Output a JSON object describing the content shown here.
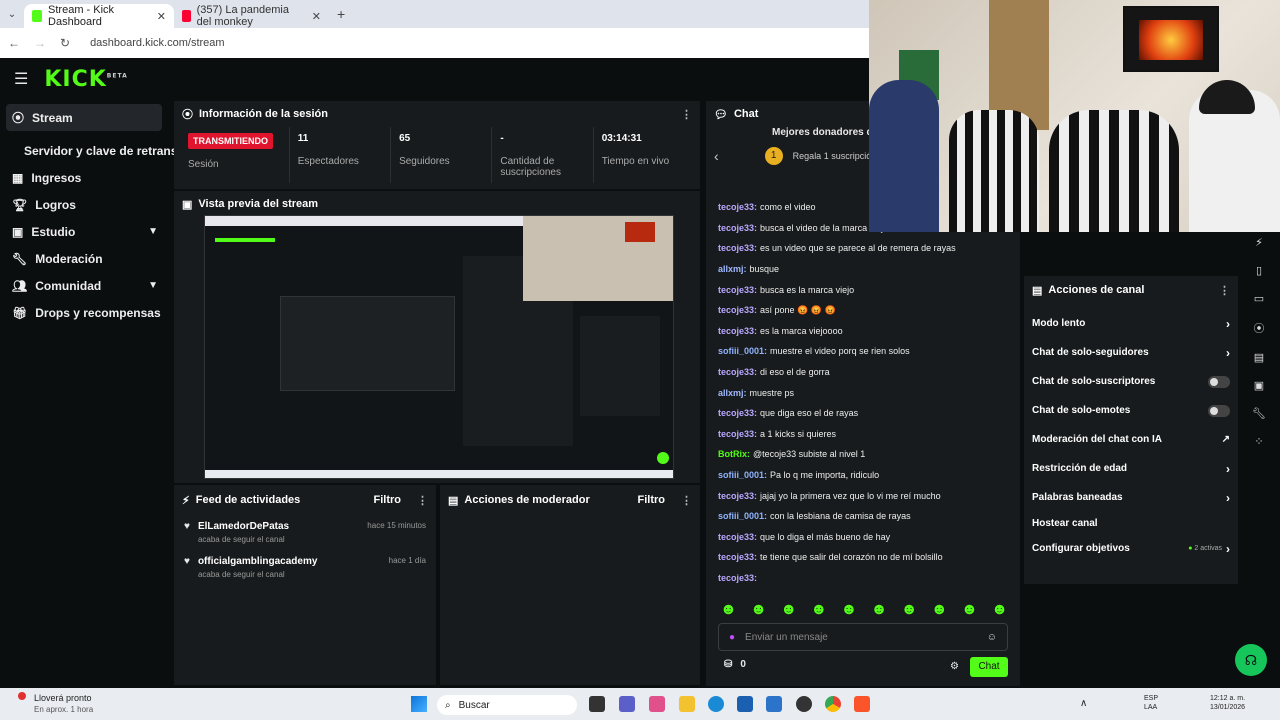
{
  "browser": {
    "tabs": [
      {
        "label": "Stream - Kick Dashboard",
        "close": "✕"
      },
      {
        "label": "(357) La pandemia del monkey",
        "close": "✕"
      }
    ],
    "new_tab": "+",
    "url": "dashboard.kick.com/stream"
  },
  "brand": {
    "logo": "KICK",
    "beta": "BETA",
    "accent": "#53fc18"
  },
  "sidebar": {
    "items": [
      {
        "label": "Stream",
        "icon": "broadcast-icon"
      },
      {
        "label": "Servidor y clave de retransm",
        "icon": ""
      },
      {
        "label": "Ingresos",
        "icon": "chart-icon"
      },
      {
        "label": "Logros",
        "icon": "trophy-icon"
      },
      {
        "label": "Estudio",
        "icon": "studio-icon"
      },
      {
        "label": "Moderación",
        "icon": "wrench-icon"
      },
      {
        "label": "Comunidad",
        "icon": "people-icon"
      },
      {
        "label": "Drops y recompensas",
        "icon": "gift-icon"
      }
    ]
  },
  "session": {
    "title": "Información de la sesión",
    "live_badge": "TRANSMITIENDO",
    "live_label": "Sesión",
    "viewers": "11",
    "viewers_label": "Espectadores",
    "followers": "65",
    "followers_label": "Seguidores",
    "subs": "-",
    "subs_label": "Cantidad de suscripciones",
    "uptime": "03:14:31",
    "uptime_label": "Tiempo en vivo"
  },
  "preview": {
    "title": "Vista previa del stream"
  },
  "feed": {
    "title": "Feed de actividades",
    "filter": "Filtro",
    "items": [
      {
        "user": "ElLamedorDePatas",
        "action": "acaba de seguir el canal",
        "time": "hace 15 minutos"
      },
      {
        "user": "officialgamblingacademy",
        "action": "acaba de seguir el canal",
        "time": "hace 1 día"
      }
    ]
  },
  "modactions": {
    "title": "Acciones de moderador",
    "filter": "Filtro"
  },
  "chat": {
    "title": "Chat",
    "top_donors": "Mejores donadores de",
    "gift_text": "Regala 1 suscripción",
    "messages": [
      {
        "user": "tecoje33:",
        "text": "como el video",
        "color": "#b9a8ff"
      },
      {
        "user": "tecoje33:",
        "text": "busca el video de la marca viejo",
        "color": "#b9a8ff"
      },
      {
        "user": "tecoje33:",
        "text": "es un video que se parece al de remera de rayas",
        "color": "#b9a8ff"
      },
      {
        "user": "allxmj:",
        "text": "busque",
        "color": "#9fb8ff"
      },
      {
        "user": "tecoje33:",
        "text": "busca es la marca viejo",
        "color": "#b9a8ff"
      },
      {
        "user": "tecoje33:",
        "text": "así pone 😡 😡 😡",
        "color": "#b9a8ff"
      },
      {
        "user": "tecoje33:",
        "text": "es la marca viejoooo",
        "color": "#b9a8ff"
      },
      {
        "user": "sofiii_0001:",
        "text": "muestre el video porq se rien solos",
        "color": "#8fb3ff"
      },
      {
        "user": "tecoje33:",
        "text": "di eso el de gorra",
        "color": "#b9a8ff"
      },
      {
        "user": "allxmj:",
        "text": "muestre ps",
        "color": "#9fb8ff"
      },
      {
        "user": "tecoje33:",
        "text": "que diga eso el de rayas",
        "color": "#b9a8ff"
      },
      {
        "user": "tecoje33:",
        "text": "a 1 kicks si quieres",
        "color": "#b9a8ff"
      },
      {
        "user": "BotRix:",
        "text": "@tecoje33 subiste al nivel 1",
        "color": "#53fc18"
      },
      {
        "user": "sofiii_0001:",
        "text": "Pa lo q me importa, ridiculo",
        "color": "#8fb3ff"
      },
      {
        "user": "tecoje33:",
        "text": "jajaj yo la primera vez que lo vi me reí mucho",
        "color": "#b9a8ff"
      },
      {
        "user": "sofiii_0001:",
        "text": "con la lesbiana de camisa de rayas",
        "color": "#8fb3ff"
      },
      {
        "user": "tecoje33:",
        "text": "que lo diga el más bueno de hay",
        "color": "#b9a8ff"
      },
      {
        "user": "tecoje33:",
        "text": "te tiene que salir del corazón no de mí bolsillo",
        "color": "#b9a8ff"
      },
      {
        "user": "tecoje33:",
        "text": "",
        "color": "#b9a8ff"
      }
    ],
    "placeholder": "Enviar un mensaje",
    "points": "0",
    "send": "Chat"
  },
  "channel_actions": {
    "title": "Acciones de canal",
    "rows": [
      {
        "label": "Modo lento",
        "control": "chevron"
      },
      {
        "label": "Chat de solo-seguidores",
        "control": "chevron"
      },
      {
        "label": "Chat de solo-suscriptores",
        "control": "toggle"
      },
      {
        "label": "Chat de solo-emotes",
        "control": "toggle"
      },
      {
        "label": "Moderación del chat con IA",
        "control": "external"
      },
      {
        "label": "Restricción de edad",
        "control": "chevron"
      },
      {
        "label": "Palabras baneadas",
        "control": "chevron"
      },
      {
        "label": "Hostear canal",
        "control": "none"
      },
      {
        "label": "Configurar objetivos",
        "control": "chevron",
        "extra": "2 activas"
      }
    ]
  },
  "taskbar": {
    "weather": "Lloverá pronto",
    "weather_sub": "En aprox. 1 hora",
    "search": "Buscar",
    "lang": "ESP",
    "lang2": "LAA",
    "time": "12:12 a. m.",
    "date": "13/01/2026"
  }
}
